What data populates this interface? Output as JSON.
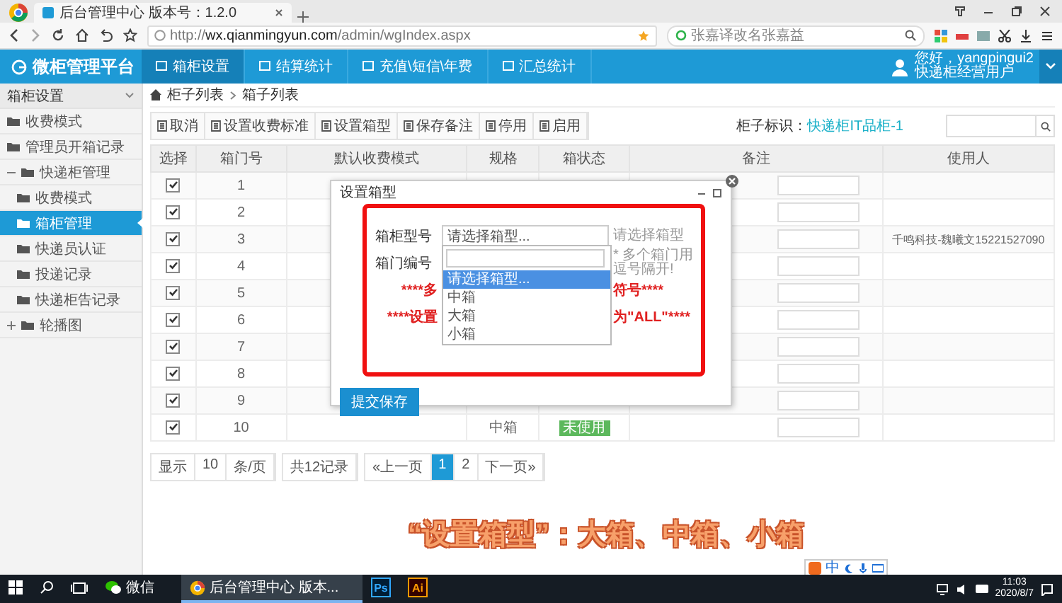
{
  "browser": {
    "tab_title": "后台管理中心 版本号：1.2.0",
    "url": "http://**wx.qianmingyun.com**/admin/wgIndex.aspx",
    "search": "张嘉译改名张嘉益"
  },
  "app": {
    "logo": "微柜管理平台",
    "nav": [
      {
        "label": "箱柜设置",
        "selected": true
      },
      {
        "label": "结算统计",
        "selected": false
      },
      {
        "label": "充值\\短信\\年费",
        "selected": false
      },
      {
        "label": "汇总统计",
        "selected": false
      }
    ],
    "user_greeting": "您好，yangpingui2",
    "user_role": "快递柜经营用户"
  },
  "sidebar": {
    "title": "箱柜设置",
    "items": [
      {
        "label": "收费模式",
        "kind": "link",
        "selected": false
      },
      {
        "label": "管理员开箱记录",
        "kind": "link",
        "selected": false
      },
      {
        "label": "快递柜管理",
        "kind": "group",
        "expanded": true,
        "children": [
          {
            "label": "收费模式",
            "selected": false
          },
          {
            "label": "箱柜管理",
            "selected": true
          },
          {
            "label": "快递员认证",
            "selected": false
          },
          {
            "label": "投递记录",
            "selected": false
          },
          {
            "label": "快递柜告记录",
            "selected": false
          }
        ]
      },
      {
        "label": "轮播图",
        "kind": "group",
        "expanded": false
      }
    ]
  },
  "breadcrumb": [
    "柜子列表",
    "箱子列表"
  ],
  "toolbar": [
    "取消",
    "设置收费标准",
    "设置箱型",
    "保存备注",
    "停用",
    "启用"
  ],
  "cabinet": {
    "label": "柜子标识：",
    "name": "快递柜IT品柜-1"
  },
  "table": {
    "columns": [
      "选择",
      "箱门号",
      "默认收费模式",
      "规格",
      "箱状态",
      "备注",
      "使用人"
    ],
    "rows": [
      {
        "checked": true,
        "door": "1"
      },
      {
        "checked": true,
        "door": "2"
      },
      {
        "checked": true,
        "door": "3",
        "user": "千鸣科技-魏曦文15221527090"
      },
      {
        "checked": true,
        "door": "4"
      },
      {
        "checked": true,
        "door": "5"
      },
      {
        "checked": true,
        "door": "6"
      },
      {
        "checked": true,
        "door": "7"
      },
      {
        "checked": true,
        "door": "8"
      },
      {
        "checked": true,
        "door": "9"
      },
      {
        "checked": true,
        "door": "10",
        "spec": "中箱",
        "status": "未使用"
      }
    ]
  },
  "pagination": {
    "show": "显示",
    "size": "10",
    "unit": "条/页",
    "total": "共12记录",
    "prev": "«上一页",
    "pages": [
      {
        "label": "1",
        "selected": true
      },
      {
        "label": "2",
        "selected": false
      }
    ],
    "next": "下一页»"
  },
  "dialog": {
    "title": "设置箱型",
    "type_label": "箱柜型号",
    "type_value": "请选择箱型...",
    "type_hint": "请选择箱型",
    "door_label": "箱门编号",
    "door_hint": "* 多个箱门用逗号隔开!",
    "notes": [
      [
        "****多",
        "符号****"
      ],
      [
        "****设置",
        "为\"ALL\"****"
      ]
    ],
    "options": [
      {
        "label": "请选择箱型...",
        "selected": true
      },
      {
        "label": "中箱",
        "selected": false
      },
      {
        "label": "大箱",
        "selected": false
      },
      {
        "label": "小箱",
        "selected": false
      }
    ],
    "submit": "提交保存"
  },
  "caption": "“设置箱型”：大箱、中箱、小箱",
  "ime": "中",
  "taskbar": {
    "apps": [
      {
        "kind": "wechat",
        "label": "微信",
        "selected": false
      },
      {
        "kind": "browser",
        "label": "后台管理中心 版本...",
        "selected": true
      },
      {
        "kind": "ps",
        "label": "Ps",
        "selected": false
      },
      {
        "kind": "ai",
        "label": "Ai",
        "selected": false
      }
    ],
    "time": "11:03",
    "date": "2020/8/7"
  }
}
